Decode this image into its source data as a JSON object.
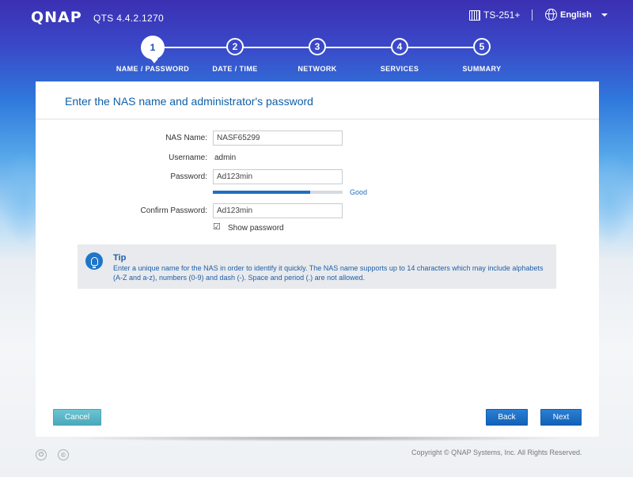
{
  "header": {
    "logo": "QNAP",
    "version": "QTS 4.4.2.1270",
    "device": "TS-251+",
    "language": "English"
  },
  "steps": [
    {
      "number": "1",
      "label": "NAME / PASSWORD",
      "active": true
    },
    {
      "number": "2",
      "label": "DATE / TIME",
      "active": false
    },
    {
      "number": "3",
      "label": "NETWORK",
      "active": false
    },
    {
      "number": "4",
      "label": "SERVICES",
      "active": false
    },
    {
      "number": "5",
      "label": "SUMMARY",
      "active": false
    }
  ],
  "panel": {
    "title": "Enter the NAS name and administrator's password"
  },
  "form": {
    "nas_name_label": "NAS Name:",
    "nas_name_value": "NASF65299",
    "username_label": "Username:",
    "username_value": "admin",
    "password_label": "Password:",
    "password_value": "Ad123min",
    "strength_label": "Good",
    "strength_level": 0.75,
    "confirm_label": "Confirm Password:",
    "confirm_value": "Ad123min",
    "show_password_label": "Show password",
    "show_password_checked": true
  },
  "tip": {
    "title": "Tip",
    "text": "Enter a unique name for the NAS in order to identify it quickly. The NAS name supports up to 14 characters which may include alphabets (A-Z and a-z), numbers (0-9) and dash (-). Space and period (.) are not allowed."
  },
  "buttons": {
    "cancel": "Cancel",
    "back": "Back",
    "next": "Next"
  },
  "footer": {
    "copyright": "Copyright © QNAP Systems, Inc. All Rights Reserved.",
    "icons": [
      "power-icon",
      "copyright-icon"
    ]
  },
  "colors": {
    "accent": "#1f6fc1",
    "title": "#0f5fa8",
    "cancel": "#5bb8c9"
  }
}
